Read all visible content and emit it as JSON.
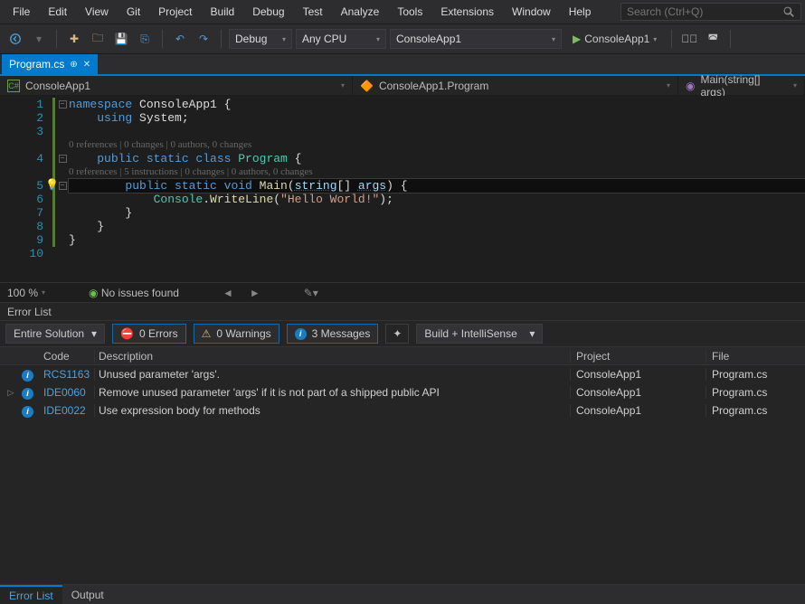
{
  "menu": [
    "File",
    "Edit",
    "View",
    "Git",
    "Project",
    "Build",
    "Debug",
    "Test",
    "Analyze",
    "Tools",
    "Extensions",
    "Window",
    "Help"
  ],
  "search_placeholder": "Search (Ctrl+Q)",
  "toolbar": {
    "config": "Debug",
    "platform": "Any CPU",
    "startup": "ConsoleApp1",
    "run_target": "ConsoleApp1"
  },
  "doc_tab": {
    "filename": "Program.cs"
  },
  "breadcrumb": {
    "project": "ConsoleApp1",
    "class": "ConsoleApp1.Program",
    "member": "Main(string[] args)"
  },
  "code": {
    "l1_kw1": "namespace",
    "l1_ns": "ConsoleApp1",
    "l1_brace": " {",
    "l2_kw": "using",
    "l2_ns": "System",
    "l2_semi": ";",
    "lens1": "0 references | 0 changes | 0 authors, 0 changes",
    "l4_mods": "public static class ",
    "l4_name": "Program",
    "l4_brace": " {",
    "lens2": "0 references | 5 instructions | 0 changes | 0 authors, 0 changes",
    "l5_mods": "public static void ",
    "l5_name": "Main",
    "l5_open": "(",
    "l5_ptype": "string",
    "l5_arr": "[] ",
    "l5_pname": "args",
    "l5_close": ") {",
    "l6_pre": "            ",
    "l6_obj": "Console",
    "l6_dot": ".",
    "l6_m": "WriteLine",
    "l6_open": "(",
    "l6_str": "\"Hello World!\"",
    "l6_close": ");",
    "l7": "        }",
    "l8": "    }",
    "l9": "}"
  },
  "line_numbers": [
    "1",
    "2",
    "3",
    "4",
    "5",
    "6",
    "7",
    "8",
    "9",
    "10"
  ],
  "editor_status": {
    "zoom": "100 %",
    "issues": "No issues found"
  },
  "errorlist": {
    "title": "Error List",
    "scope": "Entire Solution",
    "errors": "0 Errors",
    "warnings": "0 Warnings",
    "messages": "3 Messages",
    "source": "Build + IntelliSense",
    "headers": {
      "code": "Code",
      "desc": "Description",
      "proj": "Project",
      "file": "File"
    },
    "rows": [
      {
        "expand": "",
        "code": "RCS1163",
        "desc": "Unused parameter 'args'.",
        "proj": "ConsoleApp1",
        "file": "Program.cs"
      },
      {
        "expand": "▷",
        "code": "IDE0060",
        "desc": "Remove unused parameter 'args' if it is not part of a shipped public API",
        "proj": "ConsoleApp1",
        "file": "Program.cs"
      },
      {
        "expand": "",
        "code": "IDE0022",
        "desc": "Use expression body for methods",
        "proj": "ConsoleApp1",
        "file": "Program.cs"
      }
    ]
  },
  "bottom_tabs": {
    "active": "Error List",
    "other": "Output"
  }
}
